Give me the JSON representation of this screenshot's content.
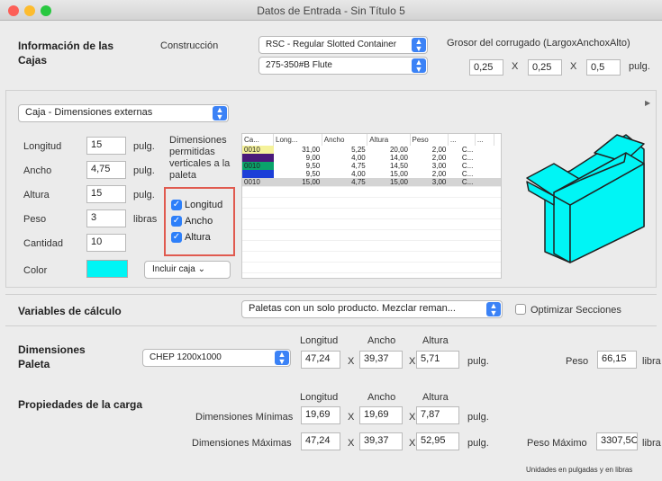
{
  "window": {
    "title": "Datos de Entrada - Sin Título 5"
  },
  "boxes": {
    "title": "Información de las Cajas",
    "construction_label": "Construcción",
    "construction_value": "RSC - Regular Slotted Container",
    "flute_value": "275-350#B Flute",
    "thickness_label": "Grosor del corrugado (LargoxAnchoxAlto)",
    "thickness": [
      "0,25",
      "0,25",
      "0,5"
    ],
    "thickness_unit": "pulg.",
    "x": "X"
  },
  "dims": {
    "mode_value": "Caja - Dimensiones externas",
    "length_label": "Longitud",
    "length_value": "15",
    "length_unit": "pulg.",
    "width_label": "Ancho",
    "width_value": "4,75",
    "width_unit": "pulg.",
    "height_label": "Altura",
    "height_value": "15",
    "height_unit": "pulg.",
    "weight_label": "Peso",
    "weight_value": "3",
    "weight_unit": "libras",
    "qty_label": "Cantidad",
    "qty_value": "10",
    "color_label": "Color",
    "color_swatch": "#00f5f5",
    "include_button": "Incluir caja"
  },
  "allowed": {
    "label": "Dimensiones permitidas verticales a la paleta",
    "checkboxes": [
      "Longitud",
      "Ancho",
      "Altura"
    ],
    "highlight_color": "#e05a4f"
  },
  "grid": {
    "headers": [
      "Ca...",
      "Long...",
      "Ancho",
      "Altura",
      "Peso",
      "...",
      "..."
    ],
    "rows": [
      {
        "code": "0010",
        "color": "#f5f29a",
        "vals": [
          "31,00",
          "5,25",
          "20,00",
          "2,00",
          "C..."
        ]
      },
      {
        "code": "",
        "color": "#4a1a7a",
        "vals": [
          "9,00",
          "4,00",
          "14,00",
          "2,00",
          "C..."
        ]
      },
      {
        "code": "0010",
        "color": "#0aa36b",
        "vals": [
          "9,50",
          "4,75",
          "14,50",
          "3,00",
          "C..."
        ]
      },
      {
        "code": "",
        "color": "#1c3fd8",
        "vals": [
          "9,50",
          "4,00",
          "15,00",
          "2,00",
          "C..."
        ]
      },
      {
        "code": "0010",
        "color": "#d4d4d4",
        "vals": [
          "15,00",
          "4,75",
          "15,00",
          "3,00",
          "C..."
        ]
      }
    ]
  },
  "calc": {
    "label": "Variables de cálculo",
    "mode_value": "Paletas con un solo producto. Mezclar reman...",
    "optimize_label": "Optimizar Secciones"
  },
  "pallet": {
    "title": "Dimensiones Paleta",
    "type_value": "CHEP 1200x1000",
    "headers": [
      "Longitud",
      "Ancho",
      "Altura"
    ],
    "values": [
      "47,24",
      "39,37",
      "5,71"
    ],
    "unit": "pulg.",
    "weight_label": "Peso",
    "weight_value": "66,15",
    "weight_unit": "libra"
  },
  "load": {
    "title": "Propiedades de la carga",
    "headers": [
      "Longitud",
      "Ancho",
      "Altura"
    ],
    "min_label": "Dimensiones Mínimas",
    "min_values": [
      "19,69",
      "19,69",
      "7,87"
    ],
    "max_label": "Dimensiones Máximas",
    "max_values": [
      "47,24",
      "39,37",
      "52,95"
    ],
    "unit": "pulg.",
    "max_weight_label": "Peso Máximo",
    "max_weight_value": "3307,5C",
    "max_weight_unit": "libra",
    "footnote": "Unidades en pulgadas y en libras"
  }
}
